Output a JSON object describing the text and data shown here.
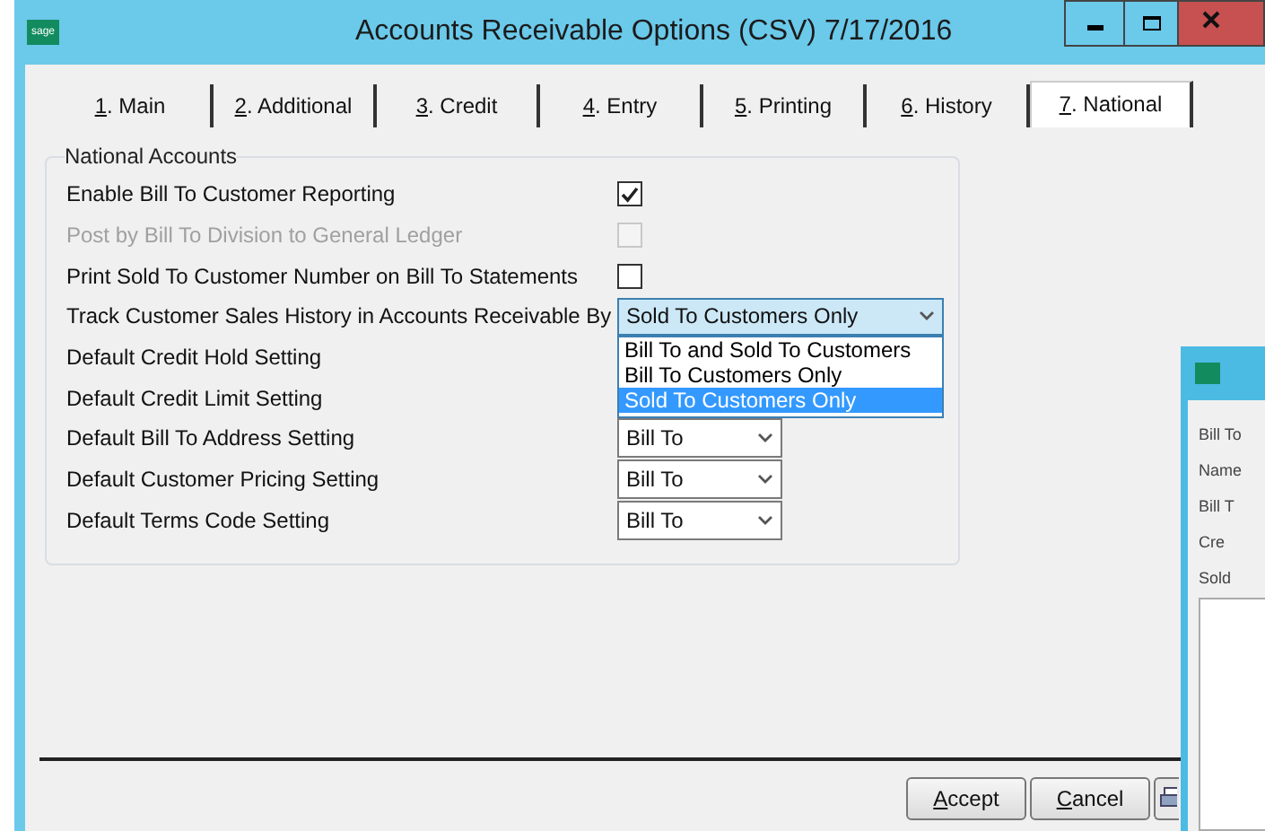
{
  "window": {
    "title": "Accounts Receivable Options (CSV) 7/17/2016",
    "logo_text": "sage"
  },
  "tabs": [
    {
      "label": "1. Main",
      "selected": false
    },
    {
      "label": "2. Additional",
      "selected": false
    },
    {
      "label": "3. Credit",
      "selected": false
    },
    {
      "label": "4. Entry",
      "selected": false
    },
    {
      "label": "5. Printing",
      "selected": false
    },
    {
      "label": "6. History",
      "selected": false
    },
    {
      "label": "7. National",
      "selected": true
    }
  ],
  "group": {
    "title": "National Accounts"
  },
  "settings": [
    {
      "kind": "checkbox",
      "label": "Enable Bill To Customer Reporting",
      "checked": true,
      "disabled": false
    },
    {
      "kind": "checkbox",
      "label": "Post by Bill To Division to General Ledger",
      "checked": false,
      "disabled": true
    },
    {
      "kind": "checkbox",
      "label": "Print Sold To Customer Number on Bill To Statements",
      "checked": false,
      "disabled": false
    },
    {
      "kind": "dropdown",
      "label": "Track Customer Sales History in Accounts Receivable By",
      "value": "Sold To Customers Only",
      "expanded": true,
      "options": [
        {
          "label": "Bill To and Sold To Customers",
          "selected": false
        },
        {
          "label": "Bill To Customers Only",
          "selected": false
        },
        {
          "label": "Sold To Customers Only",
          "selected": true
        }
      ]
    },
    {
      "kind": "dropdown",
      "label": "Default Credit Hold Setting"
    },
    {
      "kind": "dropdown",
      "label": "Default Credit Limit Setting"
    },
    {
      "kind": "dropdown",
      "label": "Default Bill To Address Setting",
      "value": "Bill To",
      "expanded": false
    },
    {
      "kind": "dropdown",
      "label": "Default Customer Pricing Setting",
      "value": "Bill To",
      "expanded": false
    },
    {
      "kind": "dropdown",
      "label": "Default Terms Code Setting",
      "value": "Bill To",
      "expanded": false
    }
  ],
  "buttons": [
    "Accept",
    "Cancel"
  ],
  "background_window": {
    "labels": [
      "Bill To",
      "Name",
      "Bill T",
      "Cre",
      "Sold"
    ]
  }
}
